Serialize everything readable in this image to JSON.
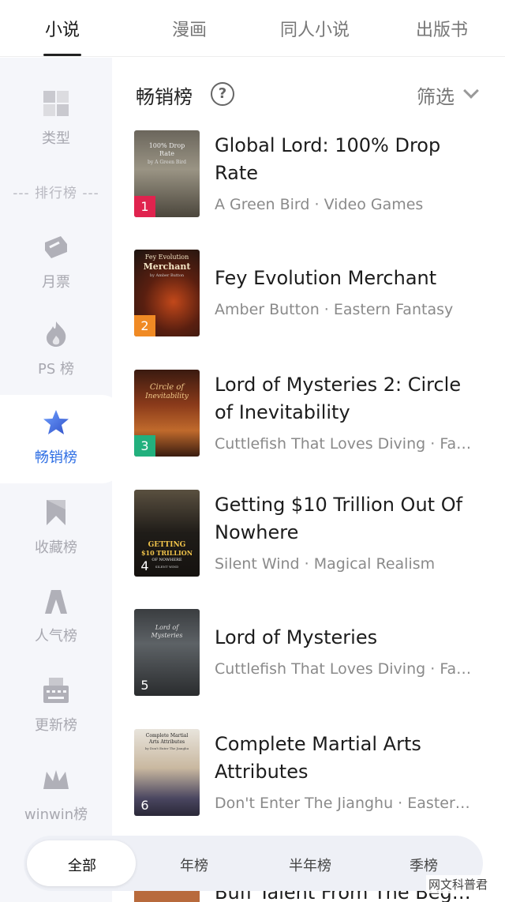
{
  "top_tabs": [
    {
      "label": "小说",
      "active": true
    },
    {
      "label": "漫画",
      "active": false
    },
    {
      "label": "同人小说",
      "active": false
    },
    {
      "label": "出版书",
      "active": false
    }
  ],
  "sidebar": {
    "category": {
      "label": "类型",
      "icon": "category-grid-icon"
    },
    "section_divider": "--- 排行榜 ---",
    "items": [
      {
        "label": "月票",
        "icon": "ticket-icon",
        "active": false
      },
      {
        "label": "PS 榜",
        "icon": "flame-icon",
        "active": false
      },
      {
        "label": "畅销榜",
        "icon": "star-icon",
        "active": true
      },
      {
        "label": "收藏榜",
        "icon": "bookmark-icon",
        "active": false
      },
      {
        "label": "人气榜",
        "icon": "popularity-icon",
        "active": false
      },
      {
        "label": "更新榜",
        "icon": "typewriter-icon",
        "active": false
      },
      {
        "label": "winwin榜",
        "icon": "crown-icon",
        "active": false
      }
    ]
  },
  "main": {
    "title": "畅销榜",
    "help_icon": "question-circle-icon",
    "filter_label": "筛选",
    "filter_icon": "chevron-down-icon"
  },
  "books": [
    {
      "rank": "1",
      "title": "Global Lord: 100% Drop Rate",
      "author": "A Green Bird",
      "genre": "Video Games",
      "rank_color": "#e0234e"
    },
    {
      "rank": "2",
      "title": "Fey Evolution Merchant",
      "author": "Amber Button",
      "genre": "Eastern Fantasy",
      "rank_color": "#f08a24"
    },
    {
      "rank": "3",
      "title": "Lord of Mysteries 2: Circle of Inevitability",
      "author": "Cuttlefish That Loves Diving",
      "genre": "Fa…",
      "rank_color": "#22b07d"
    },
    {
      "rank": "4",
      "title": "Getting $10 Trillion Out Of Nowhere",
      "author": "Silent Wind",
      "genre": "Magical Realism",
      "rank_color": "transparent"
    },
    {
      "rank": "5",
      "title": "Lord of Mysteries",
      "author": "Cuttlefish That Loves Diving",
      "genre": "Fa…",
      "rank_color": "transparent"
    },
    {
      "rank": "6",
      "title": "Complete Martial Arts Attributes",
      "author": "Don't Enter The Jianghu",
      "genre": "Easter…",
      "rank_color": "transparent"
    }
  ],
  "covers": [
    {
      "lines": [
        "100% Drop",
        "Rate"
      ],
      "sub": "by A Green Bird"
    },
    {
      "lines": [
        "Fey Evolution",
        "Merchant"
      ],
      "sub": "by Amber Button"
    },
    {
      "lines": [
        "Circle of",
        "Inevitability"
      ],
      "sub": ""
    },
    {
      "lines": [
        "GETTING",
        "$10 TRILLION",
        "OF NOWHERE"
      ],
      "sub": "SILENT WIND"
    },
    {
      "lines": [
        "Lord of",
        "Mysteries"
      ],
      "sub": ""
    },
    {
      "lines": [
        "Complete Martial",
        "Arts Attributes"
      ],
      "sub": "by Don't Enter The Jianghu"
    }
  ],
  "peek_title": "Buff Talent From The Beg…",
  "period_tabs": [
    {
      "label": "全部",
      "active": true
    },
    {
      "label": "年榜",
      "active": false
    },
    {
      "label": "半年榜",
      "active": false
    },
    {
      "label": "季榜",
      "active": false
    }
  ],
  "watermark": "网文科普君",
  "colors": {
    "accent": "#2f6fe4",
    "sidebar_bg": "#f5f6fa"
  }
}
